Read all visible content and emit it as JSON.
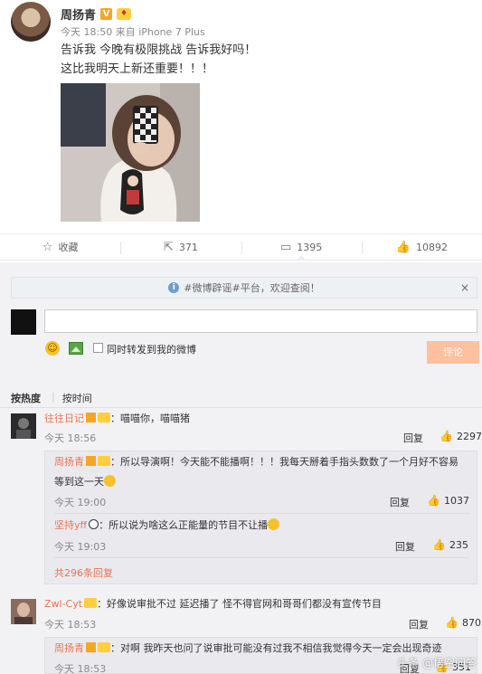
{
  "post": {
    "author": "周扬青",
    "meta": "今天 18:50 来自 iPhone 7 Plus",
    "text_line1": "告诉我 今晚有极限挑战 告诉我好吗！",
    "text_line2": "这比我明天上新还重要！！！"
  },
  "actions": {
    "favorite": "收藏",
    "repost": "371",
    "comment": "1395",
    "like": "10892"
  },
  "comment_panel": {
    "notice": "#微博辟谣#平台，欢迎查阅！",
    "repost_label": "同时转发到我的微博",
    "submit_label": "评论",
    "sort_hot": "按热度",
    "sort_time": "按时间"
  },
  "comments": [
    {
      "user": "往往日记",
      "text": "：喵喵你，喵喵猪",
      "time": "今天 18:56",
      "reply_label": "回复",
      "likes": "2297",
      "replies": [
        {
          "user": "周扬青",
          "text_line1": "：所以导演啊！今天能不能播啊！！！我每天掰着手指头数数了一个月好不容易",
          "text_line2": "等到这一天",
          "time": "今天 19:00",
          "reply_label": "回复",
          "likes": "1037"
        },
        {
          "user": "坚持yff",
          "text": "：所以说为啥这么正能量的节目不让播",
          "time": "今天 19:03",
          "reply_label": "回复",
          "likes": "235"
        }
      ],
      "more_replies": "共296条回复"
    },
    {
      "user": "Zwl-Cyt",
      "text": "：好像说审批不过 延迟播了 怪不得官网和哥哥们都没有宣传节目",
      "time": "今天 18:53",
      "reply_label": "回复",
      "likes": "870",
      "replies": [
        {
          "user": "周扬青",
          "text": "：对啊 我昨天也问了说审批可能没有过我不相信我觉得今天一定会出现奇迹",
          "time": "今天 18:53",
          "reply_label": "回复",
          "likes": "351"
        }
      ]
    }
  ],
  "watermark": "头条 @悟空问答",
  "colors": {
    "accent": "#eb7350",
    "submit": "#ffc09f"
  }
}
